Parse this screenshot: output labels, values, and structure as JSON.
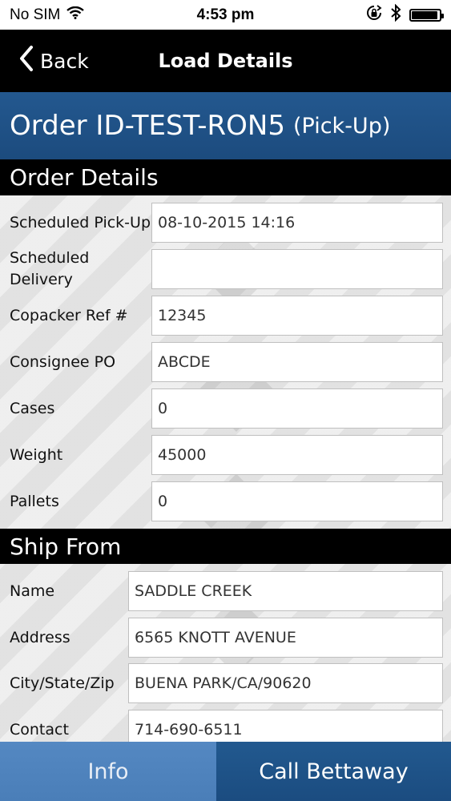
{
  "status_bar": {
    "carrier": "No SIM",
    "time": "4:53 pm",
    "battery_level": 0.95
  },
  "nav": {
    "back_label": "Back",
    "title": "Load Details"
  },
  "order": {
    "title": "Order ID-TEST-RON5",
    "type": "(Pick-Up)"
  },
  "order_details": {
    "section_title": "Order Details",
    "fields": [
      {
        "label": "Scheduled Pick-Up",
        "value": "08-10-2015 14:16"
      },
      {
        "label": "Scheduled Delivery",
        "value": ""
      },
      {
        "label": "Copacker Ref #",
        "value": "12345"
      },
      {
        "label": "Consignee PO",
        "value": "ABCDE"
      },
      {
        "label": "Cases",
        "value": "0"
      },
      {
        "label": "Weight",
        "value": "45000"
      },
      {
        "label": "Pallets",
        "value": "0"
      }
    ]
  },
  "ship_from": {
    "section_title": "Ship From",
    "fields": [
      {
        "label": "Name",
        "value": "SADDLE CREEK"
      },
      {
        "label": "Address",
        "value": "6565 KNOTT AVENUE"
      },
      {
        "label": "City/State/Zip",
        "value": "BUENA PARK/CA/90620"
      },
      {
        "label": "Contact",
        "value": "714-690-6511"
      }
    ]
  },
  "tabs": {
    "info_label": "Info",
    "call_label": "Call Bettaway"
  },
  "colors": {
    "header_blue": "#1f5288",
    "tab_active": "#4f83bd",
    "tab_inactive": "#1e5185"
  },
  "icons": {
    "wifi": "wifi-icon",
    "orientation_lock": "orientation-lock-icon",
    "bluetooth": "bluetooth-icon",
    "battery": "battery-icon",
    "back": "chevron-left-icon"
  }
}
